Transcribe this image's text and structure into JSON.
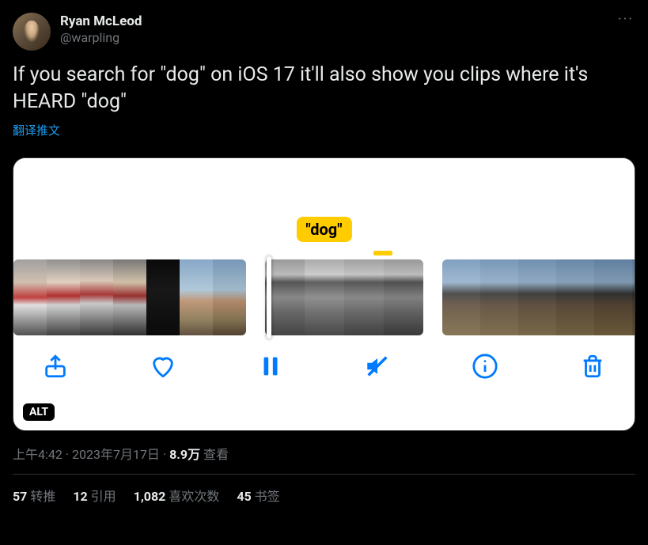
{
  "user": {
    "display_name": "Ryan McLeod",
    "handle": "@warpling"
  },
  "more_glyph": "···",
  "tweet_text": "If you search for \"dog\" on iOS 17 it'll also show you clips where it's HEARD \"dog\"",
  "translate_label": "翻译推文",
  "media": {
    "search_chip": "\"dog\"",
    "alt_badge": "ALT"
  },
  "meta": {
    "time": "上午4:42",
    "sep1": " · ",
    "date": "2023年7月17日",
    "sep2": " · ",
    "views_count": "8.9万",
    "views_label": " 查看"
  },
  "stats": {
    "retweets": {
      "count": "57",
      "label": " 转推"
    },
    "quotes": {
      "count": "12",
      "label": " 引用"
    },
    "likes": {
      "count": "1,082",
      "label": " 喜欢次数"
    },
    "bookmarks": {
      "count": "45",
      "label": " 书签"
    }
  }
}
